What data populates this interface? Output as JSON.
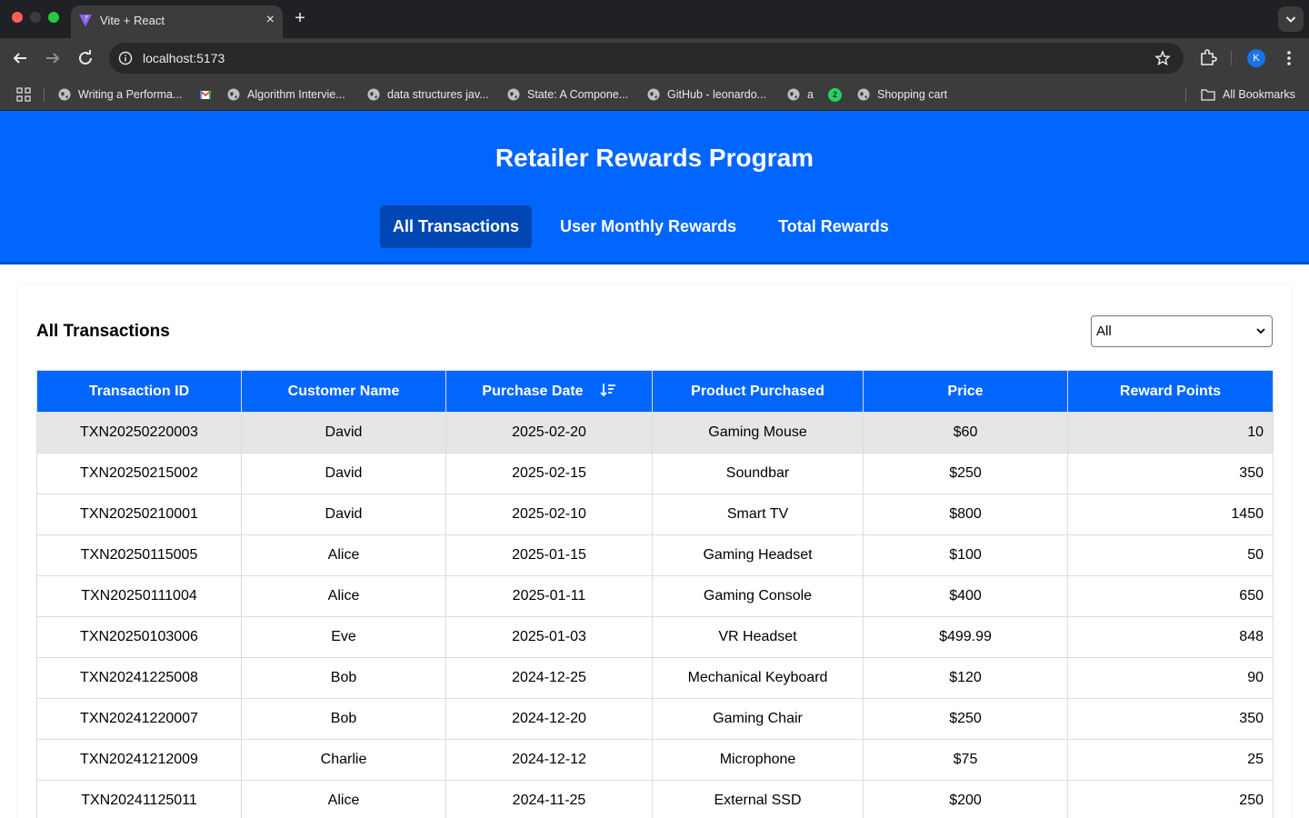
{
  "browser": {
    "tab_title": "Vite + React",
    "new_tab_symbol": "+",
    "close_symbol": "×",
    "url": "localhost:5173",
    "profile_initial": "K",
    "bookmarks": [
      {
        "label": "Writing a Performa..."
      },
      {
        "label": "Algorithm Intervie..."
      },
      {
        "label": "data structures jav..."
      },
      {
        "label": "State: A Compone..."
      },
      {
        "label": "GitHub - leonardo..."
      },
      {
        "label": "a"
      },
      {
        "label": "Shopping cart"
      }
    ],
    "notification_count": "2",
    "all_bookmarks_label": "All Bookmarks"
  },
  "app": {
    "title": "Retailer Rewards Program",
    "nav": [
      {
        "label": "All Transactions",
        "active": true
      },
      {
        "label": "User Monthly Rewards",
        "active": false
      },
      {
        "label": "Total Rewards",
        "active": false
      }
    ],
    "section_title": "All Transactions",
    "filter": {
      "selected": "All"
    },
    "colors": {
      "brand": "#0066ff",
      "active_nav": "#0047b3",
      "highlight_row": "#e6e6e6"
    }
  },
  "table": {
    "columns": [
      "Transaction ID",
      "Customer Name",
      "Purchase Date",
      "Product Purchased",
      "Price",
      "Reward Points"
    ],
    "rows": [
      [
        "TXN20250220003",
        "David",
        "2025-02-20",
        "Gaming Mouse",
        "$60",
        "10"
      ],
      [
        "TXN20250215002",
        "David",
        "2025-02-15",
        "Soundbar",
        "$250",
        "350"
      ],
      [
        "TXN20250210001",
        "David",
        "2025-02-10",
        "Smart TV",
        "$800",
        "1450"
      ],
      [
        "TXN20250115005",
        "Alice",
        "2025-01-15",
        "Gaming Headset",
        "$100",
        "50"
      ],
      [
        "TXN20250111004",
        "Alice",
        "2025-01-11",
        "Gaming Console",
        "$400",
        "650"
      ],
      [
        "TXN20250103006",
        "Eve",
        "2025-01-03",
        "VR Headset",
        "$499.99",
        "848"
      ],
      [
        "TXN20241225008",
        "Bob",
        "2024-12-25",
        "Mechanical Keyboard",
        "$120",
        "90"
      ],
      [
        "TXN20241220007",
        "Bob",
        "2024-12-20",
        "Gaming Chair",
        "$250",
        "350"
      ],
      [
        "TXN20241212009",
        "Charlie",
        "2024-12-12",
        "Microphone",
        "$75",
        "25"
      ],
      [
        "TXN20241125011",
        "Alice",
        "2024-11-25",
        "External SSD",
        "$200",
        "250"
      ]
    ]
  }
}
